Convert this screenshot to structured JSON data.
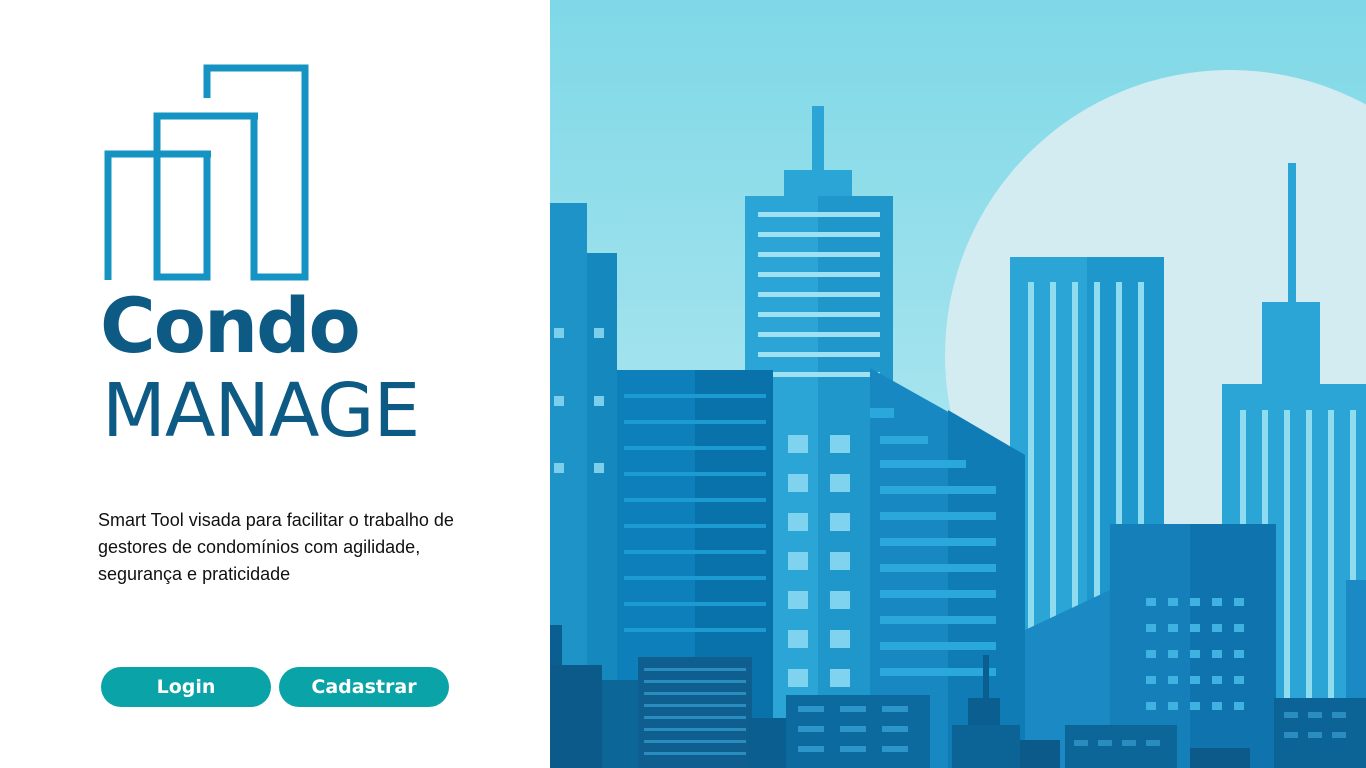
{
  "brand": {
    "name_line1": "Condo",
    "name_line2": "MANAGE",
    "logo_icon": "buildings-outline-icon",
    "color": "#0d5a85"
  },
  "hero": {
    "tagline": "Smart Tool visada para facilitar o trabalho de gestores de condomínios com agilidade, segurança e praticidade"
  },
  "actions": {
    "login_label": "Login",
    "register_label": "Cadastrar",
    "button_color": "#0aa3a8"
  },
  "illustration": {
    "name": "city-skyline-illustration",
    "sky_color": "#7fd6e6",
    "building_color": "#1a8fc4"
  }
}
